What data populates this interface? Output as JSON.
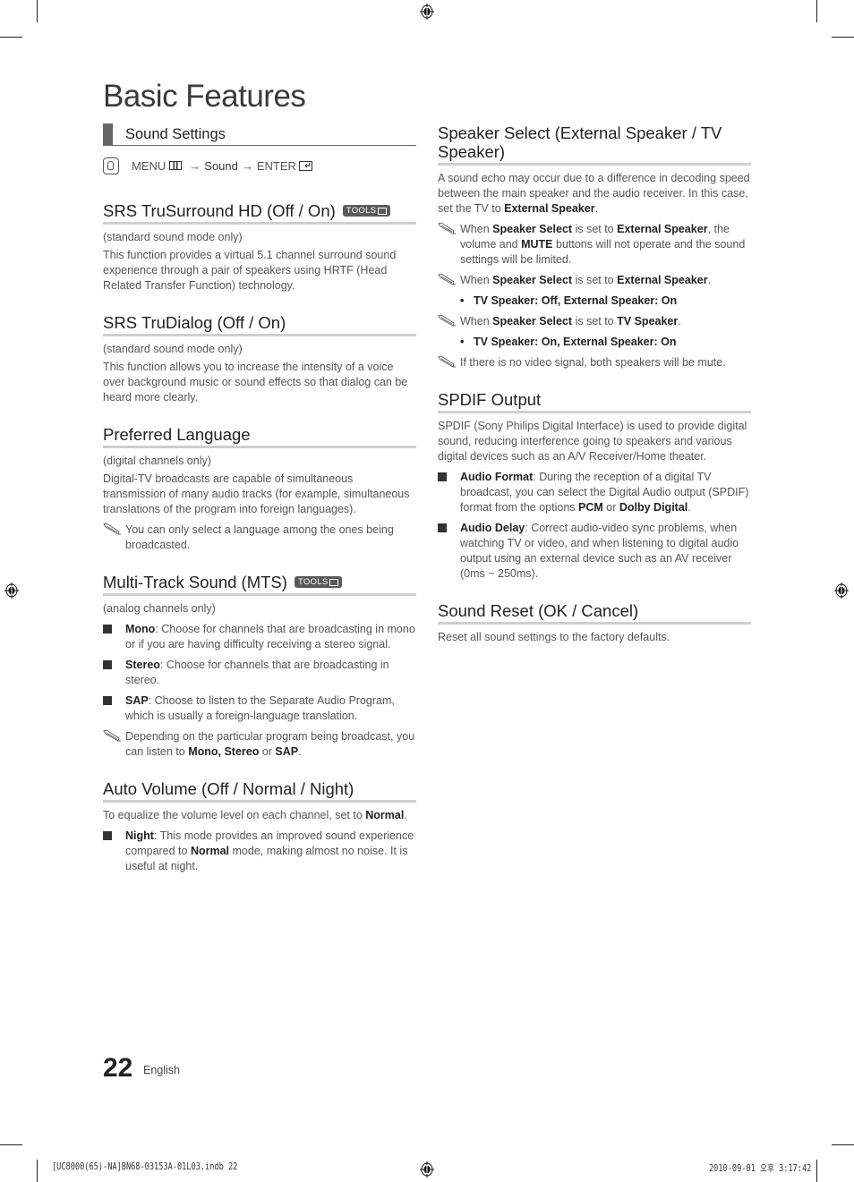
{
  "page": {
    "title": "Basic Features",
    "page_number": "22",
    "language": "English",
    "slug_left": "[UC8000(65)-NA]BN68-03153A-01L03.indb   22",
    "slug_right": "2010-09-01   오후 3:17:42"
  },
  "left": {
    "subheading": "Sound Settings",
    "menu_path": {
      "icon": "hand-pointer-icon",
      "menu": "MENU",
      "arrow1": "→",
      "sound": "Sound",
      "arrow2": "→",
      "enter": "ENTER"
    },
    "tools_label": "TOOLS",
    "sections": [
      {
        "heading": "SRS TruSurround HD (Off / On)",
        "has_tools": true,
        "note": "(standard sound mode only)",
        "body": "This function provides a virtual 5.1 channel surround sound experience through a pair of speakers using HRTF (Head Related Transfer Function) technology."
      },
      {
        "heading": "SRS TruDialog (Off / On)",
        "has_tools": false,
        "note": "(standard sound mode only)",
        "body": "This function allows you to increase the intensity of a voice over background music or sound effects so that dialog can be heard more clearly."
      },
      {
        "heading": "Preferred Language",
        "has_tools": false,
        "note": "(digital channels only)",
        "body": "Digital-TV broadcasts are capable of simultaneous transmission of many audio tracks (for example, simultaneous translations of the program into foreign languages).",
        "memo": "You can only select a language among the ones being broadcasted."
      },
      {
        "heading": "Multi-Track Sound (MTS)",
        "has_tools": true,
        "note": "(analog channels only)",
        "bullets": [
          {
            "term": "Mono",
            "text": ": Choose for channels that are broadcasting in mono or if you are having difficulty receiving a stereo signal."
          },
          {
            "term": "Stereo",
            "text": ": Choose for channels that are broadcasting in stereo."
          },
          {
            "term": "SAP",
            "text": ": Choose to listen to the Separate Audio Program, which is usually a foreign-language translation."
          }
        ],
        "memo_pre": "Depending on the particular program being broadcast, you can listen to ",
        "memo_b1": "Mono, Stereo",
        "memo_mid": " or ",
        "memo_b2": "SAP",
        "memo_end": "."
      },
      {
        "heading": "Auto Volume (Off / Normal / Night)",
        "has_tools": false,
        "body_pre": "To equalize the volume level on each channel, set to ",
        "body_b": "Normal",
        "body_end": ".",
        "bullet_term": "Night",
        "bullet_pre": ": This mode provides an improved sound experience compared to ",
        "bullet_b": "Normal",
        "bullet_end": " mode, making almost no noise. It is useful at night."
      }
    ]
  },
  "right": {
    "speaker": {
      "heading": "Speaker Select (External Speaker / TV Speaker)",
      "body_pre": "A sound echo may occur due to a difference in decoding speed between the main speaker and the audio receiver. In this case, set the TV to ",
      "body_b": "External Speaker",
      "body_end": ".",
      "memo1": {
        "t1": "When ",
        "b1": "Speaker Select",
        "t2": " is set to ",
        "b2": "External Speaker",
        "t3": ", the volume and ",
        "b3": "MUTE",
        "t4": " buttons will not operate and the sound settings will be limited."
      },
      "memo2": {
        "t1": "When ",
        "b1": "Speaker Select",
        "t2": " is set to ",
        "b2": "External Speaker",
        "t3": "."
      },
      "dot1": "TV Speaker: Off, External Speaker: On",
      "memo3": {
        "t1": "When ",
        "b1": "Speaker Select",
        "t2": " is set to ",
        "b2": "TV Speaker",
        "t3": "."
      },
      "dot2": "TV Speaker: On, External Speaker: On",
      "memo4": "If there is no video signal, both speakers will be mute."
    },
    "spdif": {
      "heading": "SPDIF Output",
      "body": "SPDIF (Sony Philips Digital Interface) is used to provide digital sound, reducing interference going to speakers and various digital devices such as an A/V Receiver/Home theater.",
      "b1_term": "Audio Format",
      "b1_pre": ": During the reception of a digital TV broadcast, you can select the Digital Audio output (SPDIF) format from the options ",
      "b1_bold1": "PCM",
      "b1_mid": " or ",
      "b1_bold2": "Dolby Digital",
      "b1_end": ".",
      "b2_term": "Audio Delay",
      "b2_text": ": Correct audio-video sync problems, when watching TV or video, and when listening to digital audio output using an external device such as an AV receiver (0ms ~ 250ms)."
    },
    "reset": {
      "heading": "Sound Reset (OK / Cancel)",
      "body": "Reset all sound settings to the factory defaults."
    }
  }
}
